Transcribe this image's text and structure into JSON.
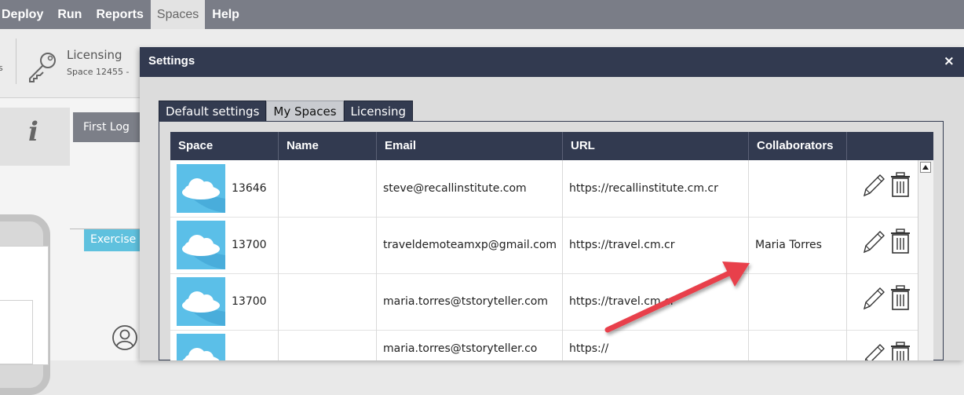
{
  "menu": {
    "items": [
      "Deploy",
      "Run",
      "Reports",
      "Spaces",
      "Help"
    ],
    "active": "Spaces"
  },
  "toolbar": {
    "cut_label": "s",
    "licensing_title": "Licensing",
    "licensing_sub": "Space 12455 - "
  },
  "background": {
    "info_glyph": "i",
    "first_log_label": "First Log",
    "exercise_label": "Exercise"
  },
  "dialog": {
    "title": "Settings",
    "close_glyph": "×",
    "tabs": [
      "Default settings",
      "My Spaces",
      "Licensing"
    ],
    "active_tab": "My Spaces",
    "columns": [
      "Space",
      "Name",
      "Email",
      "URL",
      "Collaborators",
      ""
    ],
    "rows": [
      {
        "space": "13646",
        "name": "",
        "email": "steve@recallinstitute.com",
        "url": "https://recallinstitute.cm.cr",
        "collaborators": ""
      },
      {
        "space": "13700",
        "name": "",
        "email": "traveldemoteamxp@gmail.com",
        "url": "https://travel.cm.cr",
        "collaborators": "Maria Torres"
      },
      {
        "space": "13700",
        "name": "",
        "email": "maria.torres@tstoryteller.com",
        "url": "https://travel.cm.cr",
        "collaborators": ""
      },
      {
        "space": "",
        "name": "",
        "email": "maria.torres@tstoryteller.co",
        "url": "https://",
        "collaborators": ""
      }
    ]
  },
  "colors": {
    "menubar": "#7a7d87",
    "dialog_header": "#323a50",
    "thumb": "#5bbfe8",
    "arrow": "#e8414b"
  },
  "icons": [
    "key-icon",
    "pencil-icon",
    "trash-icon",
    "cloud-icon",
    "person-icon",
    "close-icon"
  ]
}
